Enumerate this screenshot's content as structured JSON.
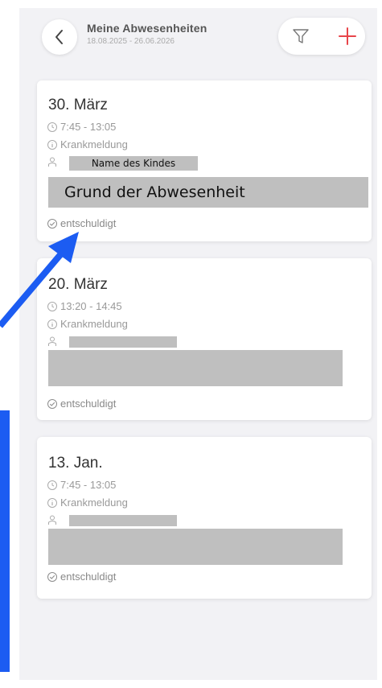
{
  "header": {
    "title": "Meine Abwesenheiten",
    "subtitle": "18.08.2025 - 26.06.2026",
    "back_icon": "chevron-left-icon",
    "filter_icon": "filter-icon",
    "add_icon": "plus-icon"
  },
  "colors": {
    "accent_red": "#e8454a",
    "annotation_blue": "#1c5cf2",
    "redaction_gray": "#bfbfbf"
  },
  "absences": [
    {
      "date": "30. März",
      "time": "7:45 - 13:05",
      "type": "Krankmeldung",
      "child_label": "Name des Kindes",
      "reason_label": "Grund der Abwesenheit",
      "status": "entschuldigt"
    },
    {
      "date": "20. März",
      "time": "13:20 - 14:45",
      "type": "Krankmeldung",
      "status": "entschuldigt"
    },
    {
      "date": "13. Jan.",
      "time": "7:45 - 13:05",
      "type": "Krankmeldung",
      "status": "entschuldigt"
    }
  ]
}
